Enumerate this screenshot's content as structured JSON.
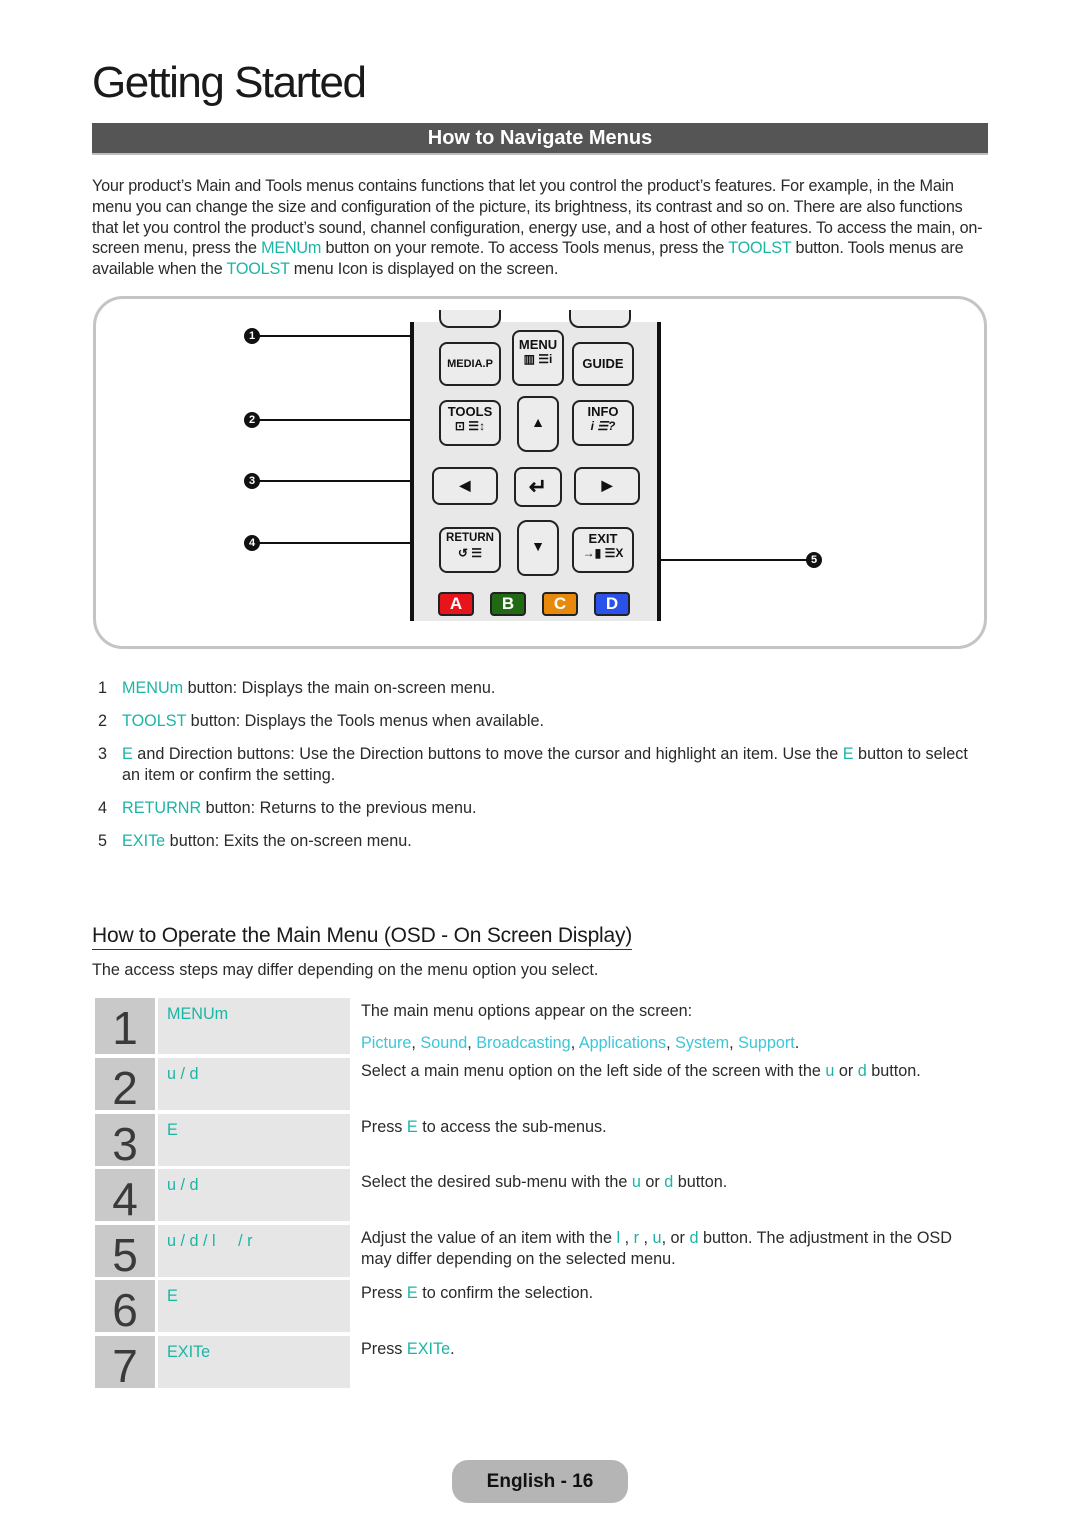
{
  "page": {
    "title": "Getting Started",
    "section_title": "How to Navigate Menus"
  },
  "intro": {
    "text1": "Your product’s Main and Tools menus contains functions that let you control the product’s features. For example, in the Main menu you can change the size and configuration of the picture, its brightness, its contrast and so on. There are also functions that let you control the product’s sound, channel configuration, energy use, and a host of other features. To access the main, on-screen menu, press the ",
    "menu_key": "MENUm",
    "text2": " button on your remote. To access Tools menus, press the ",
    "tools_key": "TOOLST",
    "text3": " button. Tools menus are available when the ",
    "tools_key2": "TOOLST",
    "text4": " menu Icon is displayed on the screen."
  },
  "remote": {
    "buttons": {
      "media_p": "MEDIA.P",
      "menu": "MENU",
      "menu_sub": "▥ ☰i",
      "guide": "GUIDE",
      "tools": "TOOLS",
      "tools_sub": "⊡ ☰↕",
      "info": "INFO",
      "info_sub": "i ☰?",
      "up": "▲",
      "left": "◀",
      "enter": "↵",
      "right": "▶",
      "return": "RETURN",
      "return_sub": "↺ ☰",
      "down": "▼",
      "exit": "EXIT",
      "exit_sub": "→▮ ☰X"
    },
    "color_buttons": [
      {
        "label": "A",
        "color": "#e8141c"
      },
      {
        "label": "B",
        "color": "#1f6a12"
      },
      {
        "label": "C",
        "color": "#e8890c"
      },
      {
        "label": "D",
        "color": "#2a52e8"
      }
    ],
    "callouts": [
      "1",
      "2",
      "3",
      "4",
      "5"
    ]
  },
  "legend": [
    {
      "num": "1",
      "key": "MENUm",
      "text": " button: Displays the main on-screen menu."
    },
    {
      "num": "2",
      "key": "TOOLST",
      "text": " button: Displays the Tools menus when available."
    },
    {
      "num": "3",
      "key": "E",
      "text": " and Direction buttons: Use the Direction buttons to move the cursor and highlight an item. Use the ",
      "key2": "E",
      "text2": " button to select an item or confirm the setting."
    },
    {
      "num": "4",
      "key": "RETURNR",
      "text": " button: Returns to the previous menu."
    },
    {
      "num": "5",
      "key": "EXITe",
      "text": " button: Exits the on-screen menu."
    }
  ],
  "operate": {
    "heading": "How to Operate the Main Menu (OSD - On Screen Display)",
    "description": "The access steps may differ depending on the menu option you select.",
    "steps": [
      {
        "num": "1",
        "key": "MENUm",
        "desc": "The main menu options appear on the screen:",
        "menu_options": [
          "Picture",
          "Sound",
          "Broadcasting",
          "Applications",
          "System",
          "Support"
        ]
      },
      {
        "num": "2",
        "key": "u / d",
        "desc_a": "Select a main menu option on the left side of the screen with the ",
        "k1": "u",
        "desc_b": " or ",
        "k2": "d",
        "desc_c": " button."
      },
      {
        "num": "3",
        "key": "E",
        "desc_a": "Press ",
        "k1": "E",
        "desc_b": " to access the sub-menus."
      },
      {
        "num": "4",
        "key": "u / d",
        "desc_a": "Select the desired sub-menu with the ",
        "k1": "u",
        "desc_b": " or ",
        "k2": "d",
        "desc_c": " button."
      },
      {
        "num": "5",
        "key": "u / d / l     / r",
        "desc_a": "Adjust the value of an item with the ",
        "k1": "l",
        "desc_b": " , ",
        "k2": "r",
        "desc_c": " , ",
        "k3": "u",
        "desc_d": ", or ",
        "k4": "d",
        "desc_e": " button. The adjustment in the OSD may differ depending on the selected menu."
      },
      {
        "num": "6",
        "key": "E",
        "desc_a": "Press ",
        "k1": "E",
        "desc_b": " to confirm the selection."
      },
      {
        "num": "7",
        "key": "EXITe",
        "desc_a": "Press ",
        "k1": "EXITe",
        "desc_b": "."
      }
    ]
  },
  "footer": {
    "page_label": "English - 16"
  }
}
